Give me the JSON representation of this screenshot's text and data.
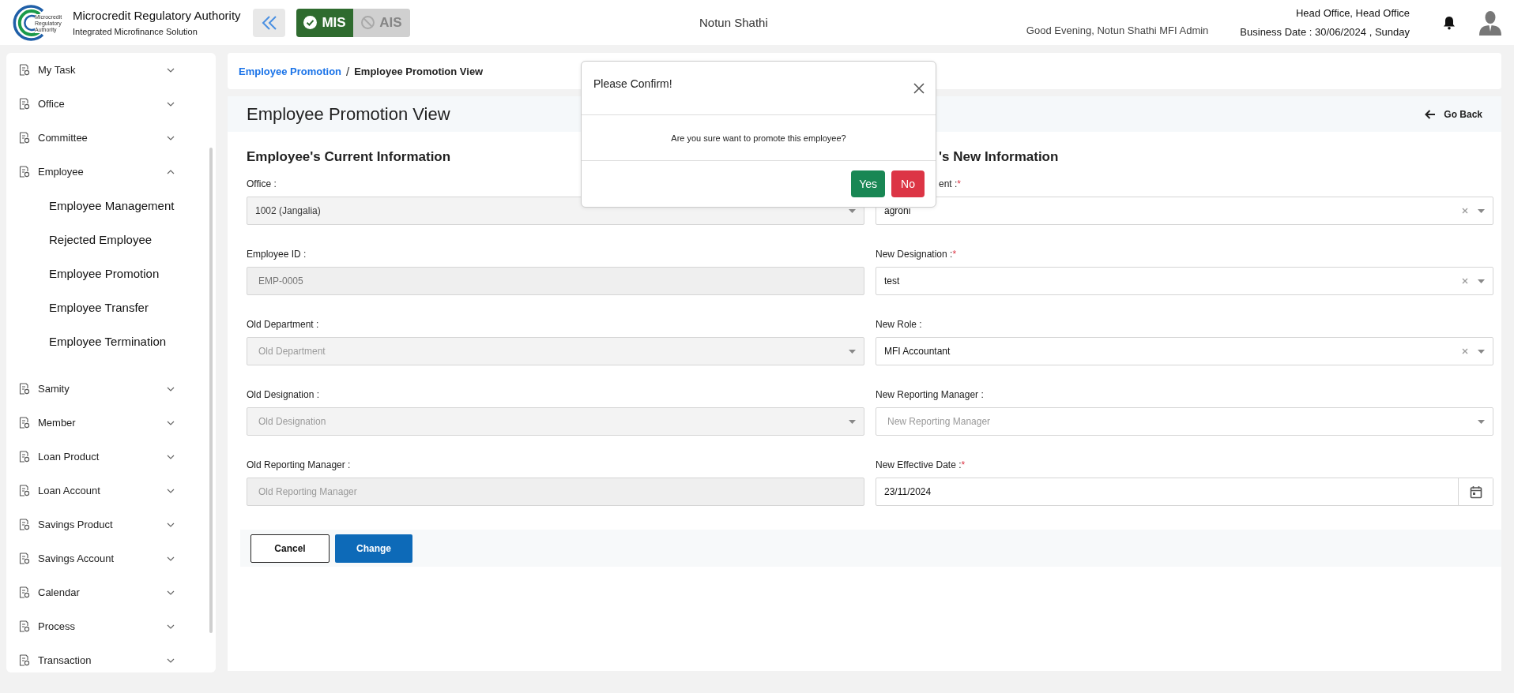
{
  "header": {
    "logo_lines": [
      "Microcredit",
      "Regulatory",
      "Authority"
    ],
    "app_title": "Microcredit Regulatory Authority",
    "app_subtitle": "Integrated Microfinance Solution",
    "modes": [
      {
        "label": "MIS",
        "selected": true
      },
      {
        "label": "AIS",
        "selected": false
      }
    ],
    "org_name": "Notun Shathi",
    "greeting": "Good Evening, Notun Shathi MFI Admin",
    "office": "Head Office, Head Office",
    "business_date": "Business Date : 30/06/2024 , Sunday"
  },
  "sidebar": {
    "items": [
      {
        "label": "My Task",
        "expanded": false
      },
      {
        "label": "Office",
        "expanded": false
      },
      {
        "label": "Committee",
        "expanded": false
      },
      {
        "label": "Employee",
        "expanded": true,
        "children": [
          {
            "label": "Employee Management"
          },
          {
            "label": "Rejected Employee"
          },
          {
            "label": "Employee Promotion"
          },
          {
            "label": "Employee Transfer"
          },
          {
            "label": "Employee Termination"
          }
        ]
      },
      {
        "label": "Samity",
        "expanded": false
      },
      {
        "label": "Member",
        "expanded": false
      },
      {
        "label": "Loan Product",
        "expanded": false
      },
      {
        "label": "Loan Account",
        "expanded": false
      },
      {
        "label": "Savings Product",
        "expanded": false
      },
      {
        "label": "Savings Account",
        "expanded": false
      },
      {
        "label": "Calendar",
        "expanded": false
      },
      {
        "label": "Process",
        "expanded": false
      },
      {
        "label": "Transaction",
        "expanded": false
      }
    ]
  },
  "breadcrumb": {
    "items": [
      {
        "label": "Employee Promotion",
        "kind": "link"
      },
      {
        "label": "Employee Promotion View",
        "kind": "current"
      }
    ],
    "separator": "/"
  },
  "page": {
    "title": "Employee Promotion View",
    "back": "Go Back"
  },
  "current_info": {
    "heading": "Employee's Current Information",
    "fields": [
      {
        "label": "Office :",
        "kind": "select",
        "value": "1002 (Jangalia)",
        "disabled": true,
        "clearable": false
      },
      {
        "label": "Employee ID :",
        "kind": "input",
        "value": "EMP-0005",
        "disabled": true,
        "clearable": false
      },
      {
        "label": "Old Department :",
        "kind": "select",
        "placeholder": "Old Department",
        "disabled": true,
        "clearable": false
      },
      {
        "label": "Old Designation :",
        "kind": "select",
        "placeholder": "Old Designation",
        "disabled": true,
        "clearable": false
      },
      {
        "label": "Old Reporting Manager :",
        "kind": "input",
        "placeholder": "Old Reporting Manager",
        "disabled": true,
        "clearable": false
      }
    ]
  },
  "new_info": {
    "heading": "'s New Information",
    "fields": [
      {
        "label": "ent :",
        "mark": "*",
        "kind": "select",
        "value": "agroni",
        "disabled": false,
        "clearable": true
      },
      {
        "label": "New Designation :",
        "mark": "*",
        "kind": "select",
        "value": "test",
        "disabled": false,
        "clearable": true
      },
      {
        "label": "New Role :",
        "kind": "select",
        "value": "MFI Accountant",
        "disabled": false,
        "clearable": true
      },
      {
        "label": "New Reporting Manager :",
        "kind": "select",
        "placeholder": "New Reporting Manager",
        "disabled": false,
        "clearable": false
      },
      {
        "label": "New Effective Date :",
        "mark": "*",
        "kind": "date",
        "value": "23/11/2024",
        "disabled": false,
        "clearable": false
      }
    ]
  },
  "actions": [
    {
      "label": "Cancel",
      "kind": "outline"
    },
    {
      "label": "Change",
      "kind": "primary"
    }
  ],
  "dialog": {
    "title": "Please Confirm!",
    "message": "Are you sure want to promote this employee?",
    "buttons": [
      {
        "label": "Yes",
        "kind": "confirm"
      },
      {
        "label": "No",
        "kind": "danger"
      }
    ]
  }
}
